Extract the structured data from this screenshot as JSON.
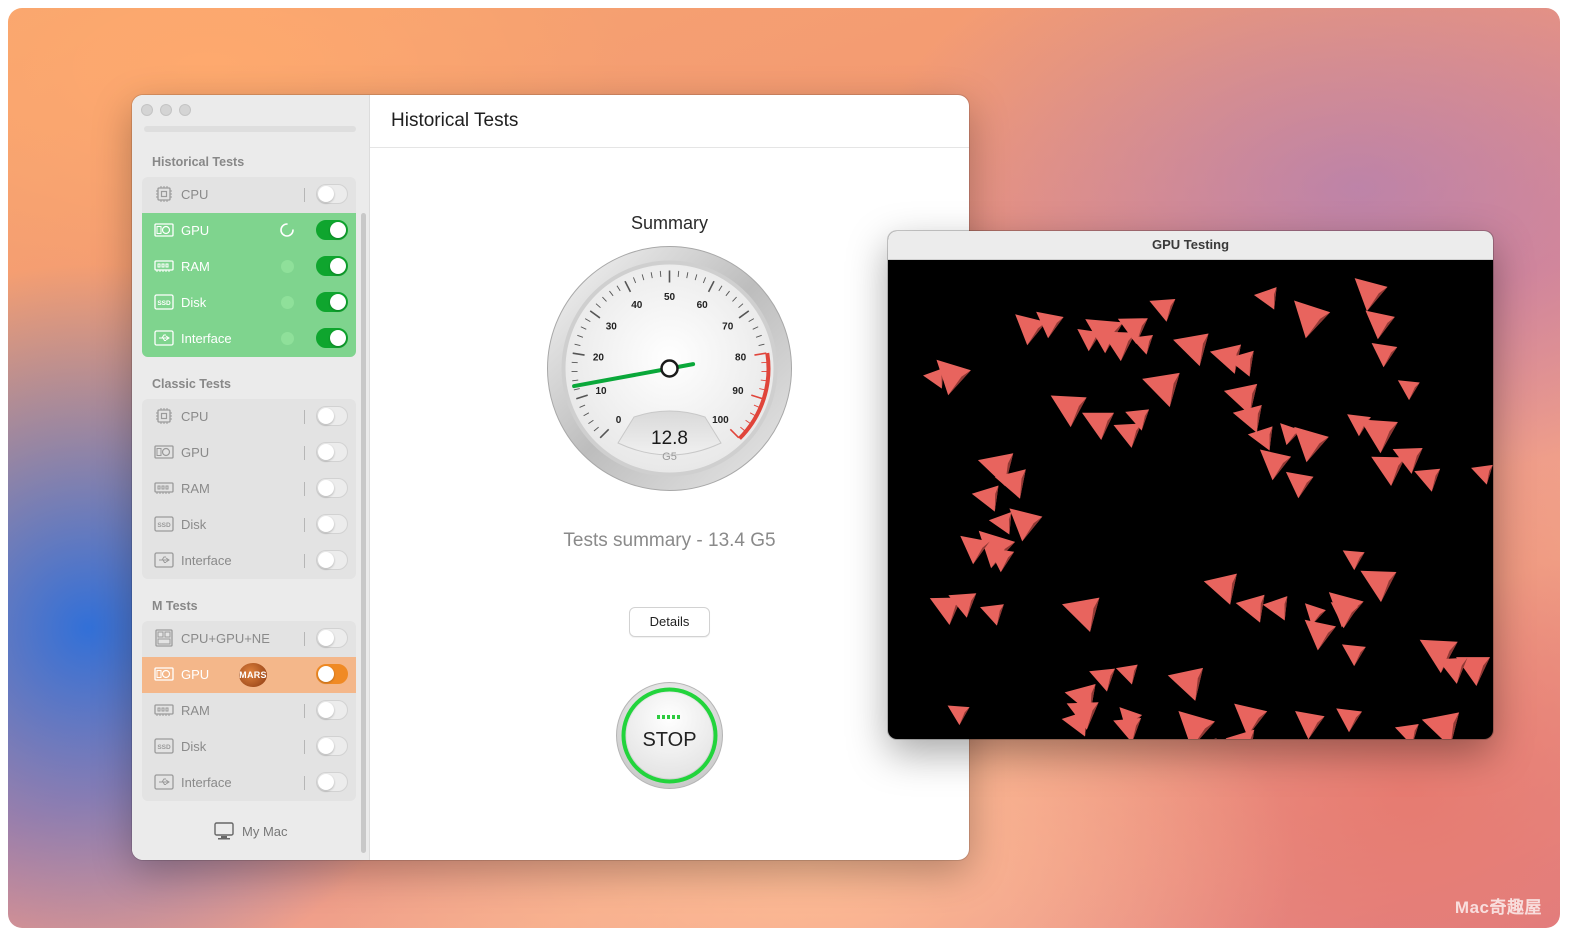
{
  "main_window": {
    "sidebar": {
      "sections": [
        {
          "title": "Historical Tests",
          "items": [
            {
              "label": "CPU",
              "icon": "cpu-icon",
              "state": "off"
            },
            {
              "label": "GPU",
              "icon": "gpu-icon",
              "state": "running"
            },
            {
              "label": "RAM",
              "icon": "ram-icon",
              "state": "on"
            },
            {
              "label": "Disk",
              "icon": "ssd-icon",
              "state": "on"
            },
            {
              "label": "Interface",
              "icon": "usb-icon",
              "state": "on"
            }
          ]
        },
        {
          "title": "Classic Tests",
          "items": [
            {
              "label": "CPU",
              "icon": "cpu-icon",
              "state": "off"
            },
            {
              "label": "GPU",
              "icon": "gpu-icon",
              "state": "off"
            },
            {
              "label": "RAM",
              "icon": "ram-icon",
              "state": "off"
            },
            {
              "label": "Disk",
              "icon": "ssd-icon",
              "state": "off"
            },
            {
              "label": "Interface",
              "icon": "usb-icon",
              "state": "off"
            }
          ]
        },
        {
          "title": "M Tests",
          "items": [
            {
              "label": "CPU+GPU+NE",
              "icon": "soc-icon",
              "state": "off"
            },
            {
              "label": "GPU",
              "icon": "gpu-icon",
              "state": "selected",
              "badge": "MARS"
            },
            {
              "label": "RAM",
              "icon": "ram-icon",
              "state": "off"
            },
            {
              "label": "Disk",
              "icon": "ssd-icon",
              "state": "off"
            },
            {
              "label": "Interface",
              "icon": "usb-icon",
              "state": "off"
            }
          ]
        }
      ],
      "footer": {
        "label": "My Mac",
        "icon": "monitor-icon"
      }
    },
    "content": {
      "title": "Historical Tests",
      "summary_label": "Summary",
      "gauge": {
        "value": 12.8,
        "value_text": "12.8",
        "unit": "G5",
        "min": 0,
        "max": 100,
        "tick_labels": [
          "0",
          "10",
          "20",
          "30",
          "40",
          "50",
          "60",
          "70",
          "80",
          "90",
          "100"
        ]
      },
      "tests_summary": "Tests summary - 13.4 G5",
      "details_button": "Details",
      "stop_button": "STOP"
    }
  },
  "gpu_window": {
    "title": "GPU Testing"
  },
  "watermark": "Mac奇趣屋",
  "colors": {
    "active_green": "#0fa52e",
    "selected_orange": "#f08a24",
    "gauge_red": "#e0443a",
    "needle_green": "#0aa83a",
    "triangle": "#e8645e"
  }
}
